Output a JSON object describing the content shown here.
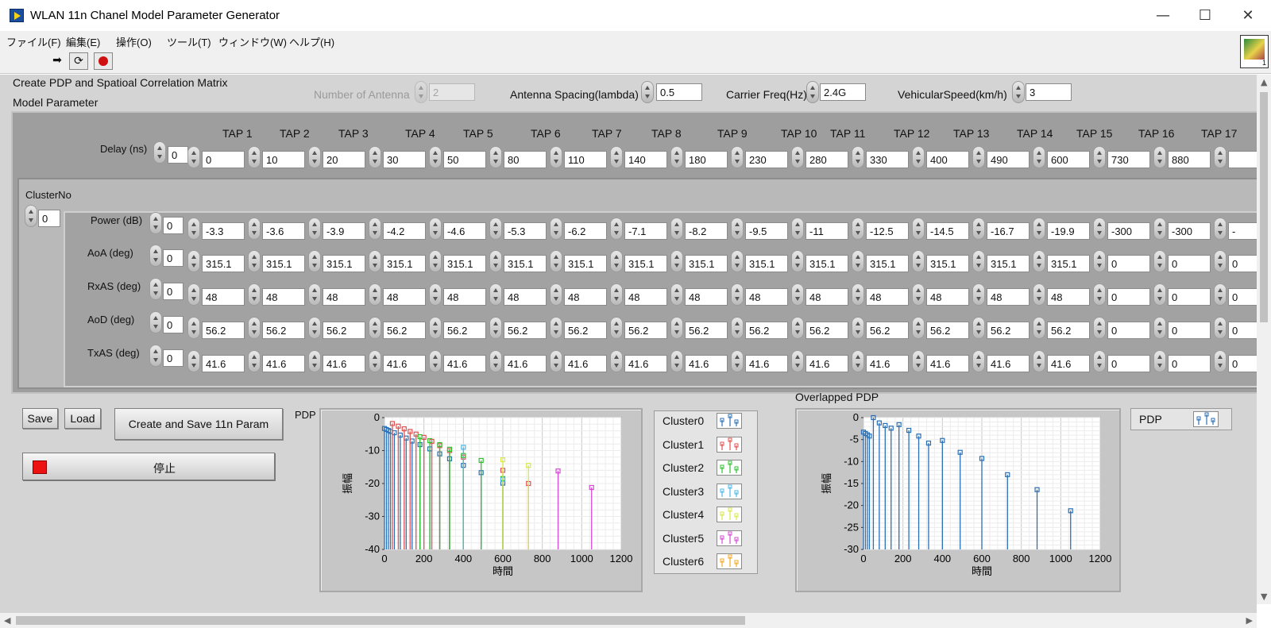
{
  "window": {
    "title": "WLAN 11n Chanel Model Parameter Generator",
    "minimize": "—",
    "maximize": "☐",
    "close": "✕"
  },
  "menu": [
    "ファイル(F)",
    "編集(E)",
    "操作(O)",
    "ツール(T)",
    "ウィンドウ(W)",
    "ヘルプ(H)"
  ],
  "toolbar": {
    "run_icon": "run-arrow-icon",
    "run_continuous_icon": "run-continuously-icon",
    "abort_icon": "abort-icon"
  },
  "vi_icon": {
    "number": "1"
  },
  "panel": {
    "heading": "Create PDP and Spatioal Correlation Matrix",
    "model_parameter_label": "Model Parameter",
    "number_of_antenna": {
      "label": "Number of Antenna",
      "value": "2"
    },
    "antenna_spacing": {
      "label": "Antenna Spacing(lambda)",
      "value": "0.5"
    },
    "carrier_freq": {
      "label": "Carrier Freq(Hz)",
      "value": "2.4G"
    },
    "vehicular_speed": {
      "label": "VehicularSpeed(km/h)",
      "value": "3"
    }
  },
  "taps": [
    "TAP 1",
    "TAP 2",
    "TAP 3",
    "TAP 4",
    "TAP 5",
    "TAP 6",
    "TAP 7",
    "TAP 8",
    "TAP 9",
    "TAP 10",
    "TAP 11",
    "TAP 12",
    "TAP 13",
    "TAP 14",
    "TAP 15",
    "TAP 16",
    "TAP 17",
    "T"
  ],
  "delay": {
    "label": "Delay (ns)",
    "index": "0",
    "values": [
      "0",
      "10",
      "20",
      "30",
      "50",
      "80",
      "110",
      "140",
      "180",
      "230",
      "280",
      "330",
      "400",
      "490",
      "600",
      "730",
      "880",
      ""
    ]
  },
  "cluster": {
    "label": "ClusterNo",
    "index": "0"
  },
  "rows": [
    {
      "label": "Power (dB)",
      "index": "0",
      "values": [
        "-3.3",
        "-3.6",
        "-3.9",
        "-4.2",
        "-4.6",
        "-5.3",
        "-6.2",
        "-7.1",
        "-8.2",
        "-9.5",
        "-11",
        "-12.5",
        "-14.5",
        "-16.7",
        "-19.9",
        "-300",
        "-300",
        "-"
      ]
    },
    {
      "label": "AoA (deg)",
      "index": "0",
      "values": [
        "315.1",
        "315.1",
        "315.1",
        "315.1",
        "315.1",
        "315.1",
        "315.1",
        "315.1",
        "315.1",
        "315.1",
        "315.1",
        "315.1",
        "315.1",
        "315.1",
        "315.1",
        "0",
        "0",
        "0"
      ]
    },
    {
      "label": "RxAS (deg)",
      "index": "0",
      "values": [
        "48",
        "48",
        "48",
        "48",
        "48",
        "48",
        "48",
        "48",
        "48",
        "48",
        "48",
        "48",
        "48",
        "48",
        "48",
        "0",
        "0",
        "0"
      ]
    },
    {
      "label": "AoD (deg)",
      "index": "0",
      "values": [
        "56.2",
        "56.2",
        "56.2",
        "56.2",
        "56.2",
        "56.2",
        "56.2",
        "56.2",
        "56.2",
        "56.2",
        "56.2",
        "56.2",
        "56.2",
        "56.2",
        "56.2",
        "0",
        "0",
        "0"
      ]
    },
    {
      "label": "TxAS (deg)",
      "index": "0",
      "values": [
        "41.6",
        "41.6",
        "41.6",
        "41.6",
        "41.6",
        "41.6",
        "41.6",
        "41.6",
        "41.6",
        "41.6",
        "41.6",
        "41.6",
        "41.6",
        "41.6",
        "41.6",
        "0",
        "0",
        "0"
      ]
    }
  ],
  "buttons": {
    "save": "Save",
    "load": "Load",
    "create": "Create and Save 11n Param",
    "stop": "停止"
  },
  "legend": {
    "clusters": [
      {
        "name": "Cluster0",
        "color": "#2a6fb5"
      },
      {
        "name": "Cluster1",
        "color": "#e05050"
      },
      {
        "name": "Cluster2",
        "color": "#2fc02f"
      },
      {
        "name": "Cluster3",
        "color": "#4ab8e8"
      },
      {
        "name": "Cluster4",
        "color": "#d8e84a"
      },
      {
        "name": "Cluster5",
        "color": "#d44ad4"
      },
      {
        "name": "Cluster6",
        "color": "#f0a820"
      }
    ],
    "pdp": {
      "name": "PDP",
      "color": "#2a6fb5"
    }
  },
  "chart_data": [
    {
      "type": "scatter",
      "title": "PDP",
      "xlabel": "時間",
      "ylabel": "振幅",
      "xlim": [
        0,
        1200
      ],
      "ylim": [
        -40,
        0
      ],
      "xticks": [
        "0",
        "200",
        "400",
        "600",
        "800",
        "1000",
        "1200"
      ],
      "yticks": [
        "0",
        "-10",
        "-20",
        "-30",
        "-40"
      ],
      "grid": true,
      "stem": true,
      "series": [
        {
          "name": "Cluster0",
          "x": [
            0,
            10,
            20,
            30,
            50,
            80,
            110,
            140,
            180,
            230,
            280,
            330,
            400,
            490,
            600
          ],
          "y": [
            -3.3,
            -3.6,
            -3.9,
            -4.2,
            -4.6,
            -5.3,
            -6.2,
            -7.1,
            -8.2,
            -9.5,
            -11,
            -12.5,
            -14.5,
            -16.7,
            -19.9
          ]
        },
        {
          "name": "Cluster1",
          "x": [
            40,
            70,
            100,
            130,
            160,
            200,
            240,
            280,
            330,
            400,
            600,
            730
          ],
          "y": [
            -1.8,
            -2.6,
            -3.4,
            -4.2,
            -5.0,
            -6.0,
            -7.2,
            -8.5,
            -10,
            -12,
            -16,
            -20
          ]
        },
        {
          "name": "Cluster2",
          "x": [
            180,
            230,
            280,
            330,
            400,
            490,
            600
          ],
          "y": [
            -5.8,
            -7.0,
            -8.2,
            -9.6,
            -11.5,
            -13,
            -18.5
          ]
        },
        {
          "name": "Cluster3",
          "x": [
            400,
            600
          ],
          "y": [
            -9.0,
            -18.8
          ]
        },
        {
          "name": "Cluster4",
          "x": [
            600,
            730
          ],
          "y": [
            -12.8,
            -14.5
          ]
        },
        {
          "name": "Cluster5",
          "x": [
            880,
            1050
          ],
          "y": [
            -16.2,
            -21.2
          ]
        }
      ]
    },
    {
      "type": "scatter",
      "title": "Overlapped PDP",
      "xlabel": "時間",
      "ylabel": "振幅",
      "xlim": [
        0,
        1200
      ],
      "ylim": [
        -30,
        0
      ],
      "xticks": [
        "0",
        "200",
        "400",
        "600",
        "800",
        "1000",
        "1200"
      ],
      "yticks": [
        "0",
        "-5",
        "-10",
        "-15",
        "-20",
        "-25",
        "-30"
      ],
      "grid": true,
      "stem": true,
      "series": [
        {
          "name": "PDP",
          "x": [
            0,
            10,
            20,
            30,
            50,
            80,
            110,
            140,
            180,
            230,
            280,
            330,
            400,
            490,
            600,
            730,
            880,
            1050
          ],
          "y": [
            -3.3,
            -3.6,
            -3.9,
            -4.2,
            0,
            -1.2,
            -1.8,
            -2.4,
            -1.6,
            -2.9,
            -4.2,
            -5.8,
            -5.2,
            -7.9,
            -9.3,
            -13.0,
            -16.4,
            -21.2
          ]
        }
      ]
    }
  ]
}
